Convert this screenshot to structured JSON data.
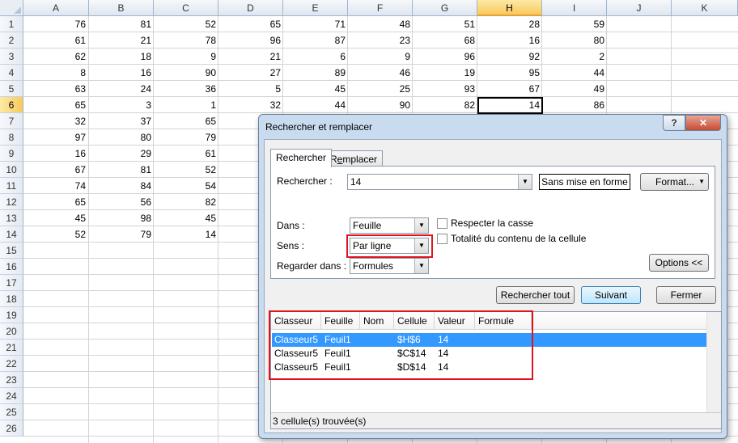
{
  "sheet": {
    "columns": [
      "A",
      "B",
      "C",
      "D",
      "E",
      "F",
      "G",
      "H",
      "I",
      "J",
      "K"
    ],
    "rows": [
      "1",
      "2",
      "3",
      "4",
      "5",
      "6",
      "7",
      "8",
      "9",
      "10",
      "11",
      "12",
      "13",
      "14",
      "15",
      "16",
      "17",
      "18",
      "19",
      "20",
      "21",
      "22",
      "23",
      "24",
      "25",
      "26"
    ],
    "selected_column": "H",
    "selected_row": "6",
    "values": [
      [
        "76",
        "81",
        "52",
        "65",
        "71",
        "48",
        "51",
        "28",
        "59"
      ],
      [
        "61",
        "21",
        "78",
        "96",
        "87",
        "23",
        "68",
        "16",
        "80"
      ],
      [
        "62",
        "18",
        "9",
        "21",
        "6",
        "9",
        "96",
        "92",
        "2"
      ],
      [
        "8",
        "16",
        "90",
        "27",
        "89",
        "46",
        "19",
        "95",
        "44"
      ],
      [
        "63",
        "24",
        "36",
        "5",
        "45",
        "25",
        "93",
        "67",
        "49"
      ],
      [
        "65",
        "3",
        "1",
        "32",
        "44",
        "90",
        "82",
        "14",
        "86"
      ],
      [
        "32",
        "37",
        "65"
      ],
      [
        "97",
        "80",
        "79"
      ],
      [
        "16",
        "29",
        "61"
      ],
      [
        "67",
        "81",
        "52"
      ],
      [
        "74",
        "84",
        "54"
      ],
      [
        "65",
        "56",
        "82"
      ],
      [
        "45",
        "98",
        "45"
      ],
      [
        "52",
        "79",
        "14"
      ]
    ]
  },
  "dialog": {
    "title": "Rechercher et remplacer",
    "help": "?",
    "close": "✕",
    "tabs": [
      "Rechercher",
      "Remplacer"
    ],
    "find_label": "Rechercher :",
    "find_value": "14",
    "format_preview": "Sans mise en forme",
    "format_button": "Format...",
    "within_label": "Dans :",
    "within_value": "Feuille",
    "search_label": "Sens :",
    "search_value": "Par ligne",
    "lookin_label": "Regarder dans :",
    "lookin_value": "Formules",
    "match_case": "Respecter la casse",
    "match_entire": "Totalité du contenu de la cellule",
    "options_button": "Options <<",
    "find_all": "Rechercher tout",
    "find_next": "Suivant",
    "close_button": "Fermer",
    "result_headers": [
      "Classeur",
      "Feuille",
      "Nom",
      "Cellule",
      "Valeur",
      "Formule"
    ],
    "results": [
      {
        "classeur": "Classeur5",
        "feuille": "Feuil1",
        "nom": "",
        "cellule": "$H$6",
        "valeur": "14",
        "formule": ""
      },
      {
        "classeur": "Classeur5",
        "feuille": "Feuil1",
        "nom": "",
        "cellule": "$C$14",
        "valeur": "14",
        "formule": ""
      },
      {
        "classeur": "Classeur5",
        "feuille": "Feuil1",
        "nom": "",
        "cellule": "$D$14",
        "valeur": "14",
        "formule": ""
      }
    ],
    "status": "3 cellule(s) trouvée(s)"
  }
}
